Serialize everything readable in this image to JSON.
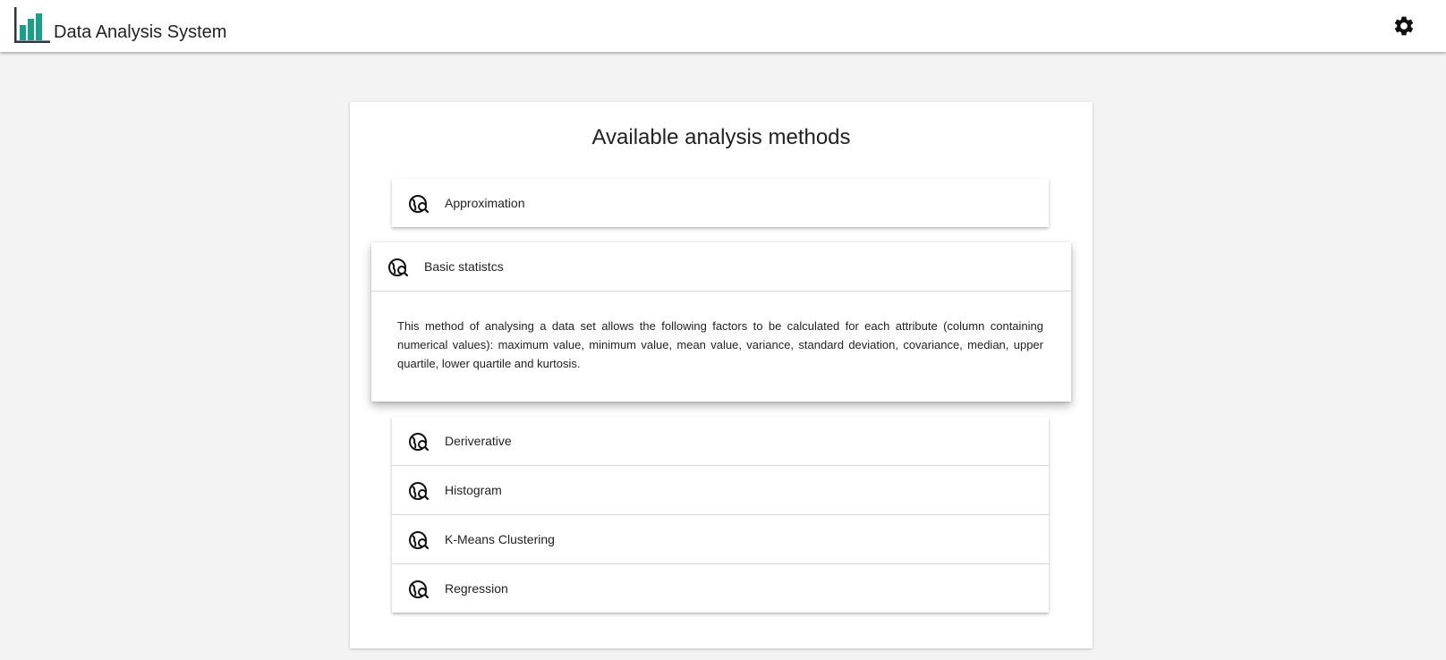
{
  "header": {
    "app_title": "Data Analysis System",
    "logo_icon": "bar-chart-logo",
    "settings_icon": "gear-icon",
    "brand_color": "#1aa08a"
  },
  "main": {
    "card_title": "Available analysis methods",
    "methods": [
      {
        "label": "Approximation",
        "icon": "travel-explore-icon",
        "expanded": false
      },
      {
        "label": "Basic statistcs",
        "icon": "travel-explore-icon",
        "expanded": true,
        "description": "This method of analysing a data set allows the following factors to be calculated for each attribute (column containing numerical values): maximum value, minimum value, mean value, variance, standard deviation, covariance, median, upper quartile, lower quartile and kurtosis."
      },
      {
        "label": "Deriverative",
        "icon": "travel-explore-icon",
        "expanded": false
      },
      {
        "label": "Histogram",
        "icon": "travel-explore-icon",
        "expanded": false
      },
      {
        "label": "K-Means Clustering",
        "icon": "travel-explore-icon",
        "expanded": false
      },
      {
        "label": "Regression",
        "icon": "travel-explore-icon",
        "expanded": false
      }
    ]
  }
}
